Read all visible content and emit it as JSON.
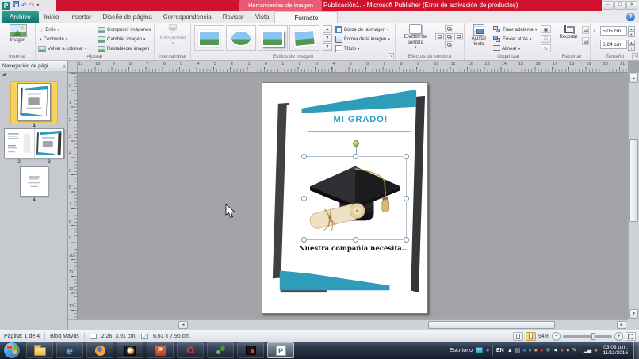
{
  "titlebar": {
    "context_header": "Herramientas de imagen",
    "title": "Publicación1. - Microsoft Publisher (Error de activación de productos)"
  },
  "tabs": {
    "file": "Archivo",
    "items": [
      "Inicio",
      "Insertar",
      "Diseño de página",
      "Correspondencia",
      "Revisar",
      "Vista"
    ],
    "contextual": "Formato"
  },
  "ribbon": {
    "groups": {
      "insertar": {
        "label": "Insertar",
        "imagen": "Imagen"
      },
      "ajustar": {
        "label": "Ajustar",
        "brillo": "Brillo",
        "contraste": "Contraste",
        "volver_a_colorear": "Volver a colorear",
        "comprimir": "Comprimir imágenes",
        "cambiar": "Cambiar imagen",
        "restablecer": "Restablecer imagen"
      },
      "intercambiar": {
        "label": "Intercambiar",
        "boton": "Intercambiar"
      },
      "estilos": {
        "label": "Estilos de imagen",
        "borde": "Borde de la imagen",
        "forma": "Forma de la imagen",
        "titulo": "Título"
      },
      "efectos_sombra": {
        "label": "Efectos de sombra",
        "boton": "Efectos de sombra"
      },
      "organizar": {
        "label": "Organizar",
        "ajustar_texto": "Ajustar texto",
        "traer_adelante": "Traer adelante",
        "enviar_atras": "Enviar atrás",
        "alinear": "Alinear"
      },
      "recortar": {
        "label": "Recortar",
        "boton": "Recortar"
      },
      "tamano": {
        "label": "Tamaño",
        "alto": "5,05 cm",
        "ancho": "6,24 cm"
      }
    }
  },
  "nav_panel": {
    "title": "Navegación de pági...",
    "pages": [
      {
        "label": "1",
        "selected": true
      },
      {
        "label": "2",
        "selected": false
      },
      {
        "label": "3",
        "selected": false
      },
      {
        "label": "4",
        "selected": false
      }
    ]
  },
  "document": {
    "heading": "MI GRADO!",
    "caption": "Nuestra compañía necesita..."
  },
  "rulers": {
    "h_numbers": [
      "11",
      "10",
      "9",
      "8",
      "7",
      "6",
      "5",
      "4",
      "3",
      "2",
      "1",
      "0",
      "1",
      "2",
      "3",
      "4",
      "5",
      "6",
      "7",
      "8",
      "9",
      "10",
      "11",
      "12",
      "13",
      "14",
      "15",
      "16",
      "17",
      "18",
      "19",
      "20",
      "21"
    ],
    "v_numbers": [
      "0",
      "1",
      "2",
      "3",
      "4",
      "5",
      "6",
      "7",
      "8",
      "9",
      "10",
      "11",
      "12",
      "13"
    ]
  },
  "status_bar": {
    "page_info": "Página: 1 de 4",
    "caps_lock": "Bloq Mayús",
    "position": "2,26, 3,91 cm.",
    "size": "6,61 x 7,96 cm.",
    "zoom_percent": "94%"
  },
  "taskbar": {
    "desktop_label": "Escritorio",
    "language": "EN",
    "clock_time": "03:03 p.m.",
    "clock_date": "11/11/2016",
    "tray": [
      {
        "name": "show-hidden-icons",
        "glyph": "▲",
        "color": "#e8edf2"
      },
      {
        "name": "touch-keyboard",
        "glyph": "▤",
        "color": "#c9d0d7"
      },
      {
        "name": "app-blue-square",
        "glyph": "■",
        "color": "#2f6fd0"
      },
      {
        "name": "skype",
        "glyph": "●",
        "color": "#3aa4e6"
      },
      {
        "name": "app-orange-dot",
        "glyph": "●",
        "color": "#f2a63e"
      },
      {
        "name": "adobe",
        "glyph": "■",
        "color": "#d32b2b"
      },
      {
        "name": "antivirus",
        "glyph": "✚",
        "color": "#4aa84a"
      },
      {
        "name": "volume",
        "glyph": "◄",
        "color": "#eef2f6"
      },
      {
        "name": "app-red-dot",
        "glyph": "●",
        "color": "#da4545"
      },
      {
        "name": "app-yellow-dot",
        "glyph": "●",
        "color": "#e9c63f"
      },
      {
        "name": "pen-input",
        "glyph": "✎",
        "color": "#d9dee3"
      },
      {
        "name": "app-maroon",
        "glyph": "▪",
        "color": "#b04a3a"
      },
      {
        "name": "network",
        "glyph": "▂▄",
        "color": "#e4e9ee"
      },
      {
        "name": "app-orange-square",
        "glyph": "■",
        "color": "#e2801f"
      }
    ]
  },
  "colors": {
    "titlebar_red": "#d0132c",
    "accent_teal": "#2f9cba",
    "file_tab_green": "#13756b",
    "selection_yellow": "#f7d25e"
  }
}
